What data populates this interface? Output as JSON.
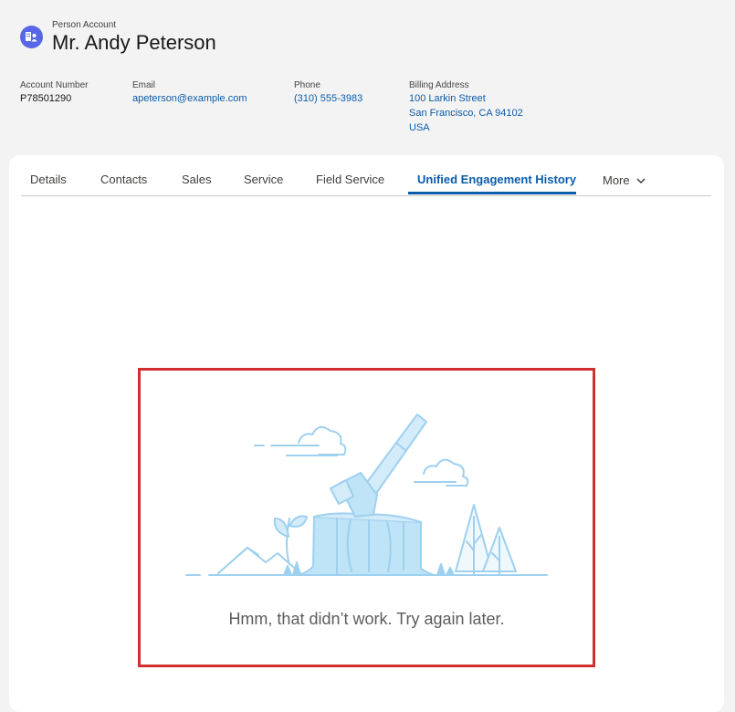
{
  "header": {
    "object_type": "Person Account",
    "record_name": "Mr. Andy Peterson",
    "icon": "person-account-icon",
    "icon_color": "#5867e8"
  },
  "fields": {
    "account_number": {
      "label": "Account Number",
      "value": "P78501290"
    },
    "email": {
      "label": "Email",
      "value": "apeterson@example.com"
    },
    "phone": {
      "label": "Phone",
      "value": "(310) 555-3983"
    },
    "billing_address": {
      "label": "Billing Address",
      "line1": "100 Larkin Street",
      "line2": "San Francisco, CA 94102",
      "line3": "USA"
    }
  },
  "tabs": [
    {
      "label": "Details"
    },
    {
      "label": "Contacts"
    },
    {
      "label": "Sales"
    },
    {
      "label": "Service"
    },
    {
      "label": "Field Service"
    },
    {
      "label": "Unified Engagement History",
      "active": true
    },
    {
      "label": "More"
    }
  ],
  "error": {
    "message": "Hmm, that didn’t work. Try again later.",
    "illustration": "axe-in-stump-illustration",
    "highlight_color": "#d32f2f"
  },
  "colors": {
    "link": "#0b5cab",
    "active_tab": "#0b5cab",
    "background": "#f3f3f3"
  }
}
